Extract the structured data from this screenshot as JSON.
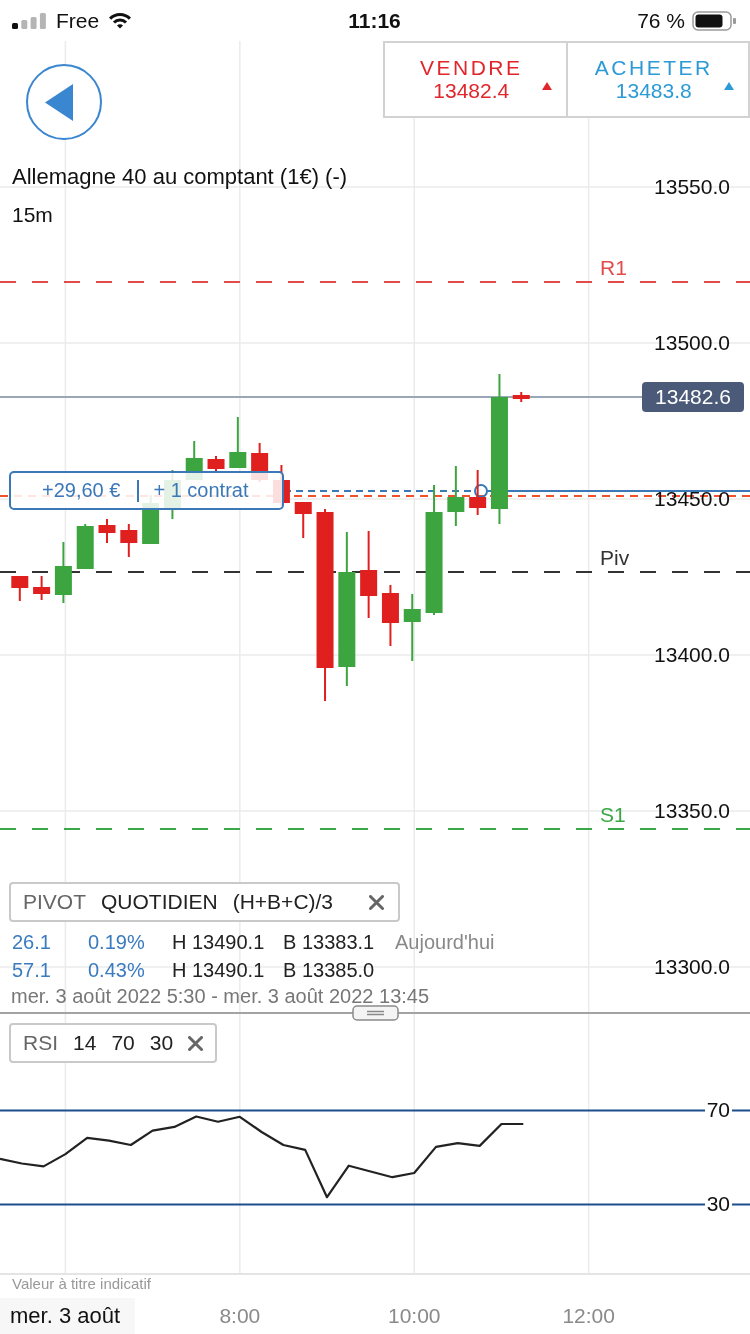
{
  "status_bar": {
    "carrier": "Free",
    "time": "11:16",
    "battery": "76 %"
  },
  "quotes": [
    {
      "label": "VENDRE",
      "price": "13482.4",
      "rising": true,
      "color": "#e0262b"
    },
    {
      "label": "ACHETER",
      "price": "13483.8",
      "rising": true,
      "color": "#2b9ad6"
    }
  ],
  "instrument": {
    "title": "Allemagne 40 au comptant (1€) (-)",
    "timeframe": "15m"
  },
  "price_axis": [
    "13550.0",
    "13500.0",
    "13450.0",
    "13400.0",
    "13350.0",
    "13300.0"
  ],
  "levels": [
    {
      "label": "R1",
      "color": "#e24b4b"
    },
    {
      "label": "Piv",
      "color": "#333333"
    },
    {
      "label": "S1",
      "color": "#3aa845"
    }
  ],
  "current_price": "13482.6",
  "position": {
    "profit": "+29,60 €",
    "size": "+ 1 contrat"
  },
  "pivot_indicator": {
    "name": "PIVOT",
    "period": "QUOTIDIEN",
    "formula": "(H+B+C)/3",
    "rows": [
      {
        "change": "26.1",
        "change_pct": "0.19%",
        "high": "H 13490.1",
        "low": "B 13383.1",
        "note": "Aujourd'hui"
      },
      {
        "change": "57.1",
        "change_pct": "0.43%",
        "high": "H 13490.1",
        "low": "B 13385.0"
      }
    ],
    "range": "mer. 3 août 2022 5:30 - mer. 3 août 2022 13:45"
  },
  "rsi_indicator": {
    "name": "RSI",
    "params": [
      "14",
      "70",
      "30"
    ],
    "chart_data": {
      "type": "line",
      "x": [
        5.25,
        5.5,
        5.75,
        6,
        6.25,
        6.5,
        6.75,
        7,
        7.25,
        7.5,
        7.75,
        8,
        8.25,
        8.5,
        8.75,
        9,
        9.25,
        9.5,
        9.75,
        10,
        10.25,
        10.5,
        10.75,
        11,
        11.25
      ],
      "series": [
        {
          "color": "#222222",
          "values": [
            49.4,
            47.4,
            46.2,
            51.4,
            58.3,
            57.1,
            55.3,
            61.4,
            63.0,
            67.4,
            65.2,
            67.3,
            60.8,
            55.3,
            53.2,
            33.1,
            46.5,
            44.0,
            41.6,
            43.4,
            54.5,
            56.1,
            54.9,
            64.2,
            64.2
          ]
        }
      ],
      "xlim": [
        5.25,
        13.85
      ],
      "ylim": [
        0,
        111
      ],
      "xticks": [
        {
          "value": 8,
          "label": "8:00"
        },
        {
          "value": 10,
          "label": "10:00"
        },
        {
          "value": 12,
          "label": "12:00"
        }
      ],
      "yticks": [
        30,
        70
      ],
      "grid": true
    }
  },
  "disclaimer": "Valeur à titre indicatif",
  "date_label": "mer. 3 août"
}
